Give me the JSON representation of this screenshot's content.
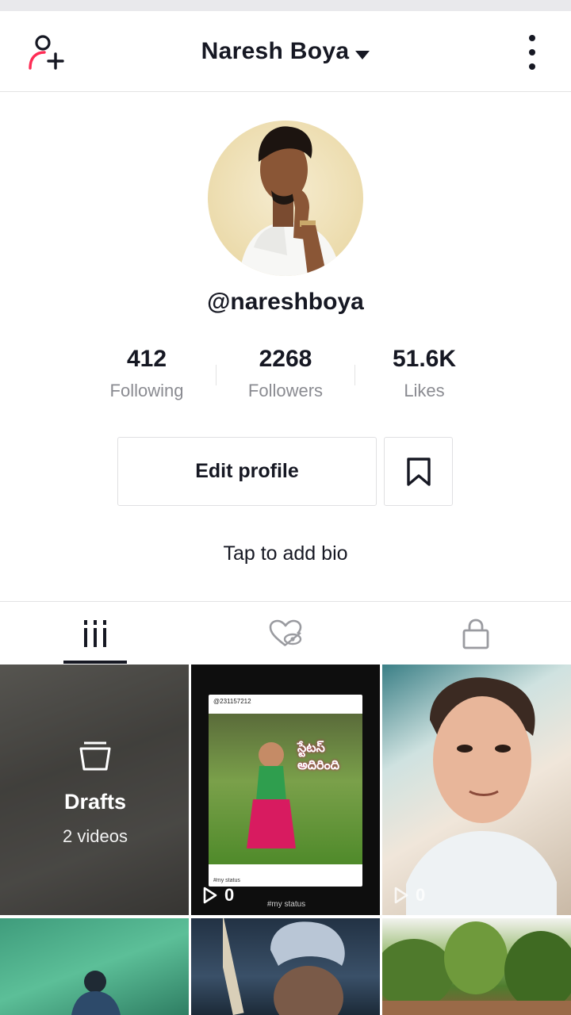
{
  "header": {
    "title": "Naresh Boya"
  },
  "profile": {
    "username": "@nareshboya",
    "stats": [
      {
        "value": "412",
        "label": "Following"
      },
      {
        "value": "2268",
        "label": "Followers"
      },
      {
        "value": "51.6K",
        "label": "Likes"
      }
    ],
    "edit_label": "Edit profile",
    "bio_prompt": "Tap to add bio"
  },
  "tabs": [
    {
      "icon": "grid-icon",
      "active": true
    },
    {
      "icon": "liked-hidden-icon",
      "active": false
    },
    {
      "icon": "lock-icon",
      "active": false
    }
  ],
  "grid": {
    "drafts": {
      "label": "Drafts",
      "count": "2 videos"
    },
    "videos": [
      {
        "plays": "0",
        "caption": "#my status",
        "card_user": "@231157212",
        "card_title": "స్టేటస్ అదిరింది",
        "card_note": "#my status"
      },
      {
        "plays": "0"
      }
    ]
  },
  "colors": {
    "text_primary": "#161823",
    "text_secondary": "#8a8b91",
    "accent": "#fe2c55"
  }
}
